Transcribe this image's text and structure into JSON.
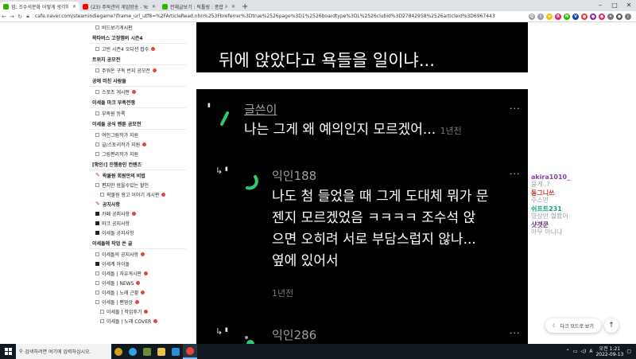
{
  "browser": {
    "tabs": [
      {
        "title": "힘: 조수석문화 어떻게 생각해?",
        "color": "#2db400",
        "active": true
      },
      {
        "title": "(23) 주둑관의 게임방송 - YouTube",
        "color": "#ff0000",
        "active": false
      },
      {
        "title": "전체글보기 : 픽툴링 : 종합 게시판",
        "color": "#2db400",
        "active": false
      }
    ],
    "new_tab": "+",
    "url": "cafe.naver.com/steamindiegame?iframe_url_utf8=%2FArticleRead.nhn%253Fbreferrer%3Dtrue%2526page%3D1%2526boardtype%3DL%2526clubid%3D27842958%2526articleid%3D6967443",
    "window_buttons": [
      "–",
      "□",
      "✕"
    ]
  },
  "sidebar": {
    "items": [
      {
        "kind": "item",
        "label": "비드보기게시판",
        "icon": true
      },
      {
        "kind": "head",
        "label": "왁타버스 고정멤버 시즌4"
      },
      {
        "kind": "item",
        "label": "고빈 시즌4 오디션 접수",
        "icon": true,
        "new": true
      },
      {
        "kind": "head",
        "label": "트위치 공모전"
      },
      {
        "kind": "item",
        "label": "주워온 구독 번지 공모전",
        "icon": true,
        "new": true
      },
      {
        "kind": "head",
        "label": "공에 미친 사람들"
      },
      {
        "kind": "item",
        "label": "스포츠 게시판",
        "icon": true,
        "new": true
      },
      {
        "kind": "head",
        "label": "이세돌 마크 부족전쟁"
      },
      {
        "kind": "item",
        "label": "부족원 등록",
        "icon": true
      },
      {
        "kind": "head",
        "label": "이세돌 공식 팬툰 공모전"
      },
      {
        "kind": "item",
        "label": "여인그림작가 지원",
        "icon": true
      },
      {
        "kind": "item",
        "label": "글/스토리작가 지원",
        "icon": true,
        "new": true
      },
      {
        "kind": "item",
        "label": "그림편리작가 지원",
        "icon": true
      },
      {
        "kind": "head",
        "label": "[확인!] 진행중인 컨텐츠"
      },
      {
        "kind": "pin",
        "label": "왁물원 회원만의 비법"
      },
      {
        "kind": "item",
        "label": "편지만 받을수있는 할인",
        "icon": true
      },
      {
        "kind": "item",
        "label": "왁물원 왕고 이야기 게시판",
        "icon": true,
        "new": true,
        "indent": true
      },
      {
        "kind": "pin",
        "label": "공지사항"
      },
      {
        "kind": "sq",
        "label": "카페 공지사항",
        "new": true
      },
      {
        "kind": "sq",
        "label": "마크 공지사항"
      },
      {
        "kind": "sq",
        "label": "이세돌 공지사항"
      },
      {
        "kind": "head",
        "label": "이세돌에 작업 쓴 글"
      },
      {
        "kind": "item",
        "label": "이세돌의 공지사항",
        "icon": true,
        "new": true
      },
      {
        "kind": "sq",
        "label": "이세계 아이돌"
      },
      {
        "kind": "item",
        "label": "이세돌 | 자유게시판",
        "icon": true,
        "new": true
      },
      {
        "kind": "item",
        "label": "이세돌 | NEWS",
        "icon": true,
        "new": true
      },
      {
        "kind": "item",
        "label": "이세돌 | 노래 근황",
        "icon": true,
        "new": true
      },
      {
        "kind": "item",
        "label": "이세돌 | 팬영상",
        "icon": true,
        "new": true
      },
      {
        "kind": "item",
        "label": "이세돌 | 작업후기",
        "icon": true,
        "new": true,
        "indent": true
      },
      {
        "kind": "item",
        "label": "이세돌 | 노래 COVER",
        "icon": true,
        "new": true,
        "indent": true
      }
    ]
  },
  "post": {
    "top_text": "뒤에 앉았다고 욕들을 일이냐..."
  },
  "comments": [
    {
      "author": "글쓴이",
      "text": "나는 그게 왜 예의인지 모르겠어...",
      "time": "1년전",
      "deco_color": "#2ecc71",
      "reply": false
    },
    {
      "author": "익인188",
      "lines": [
        "나도 첨 들었을 때 그게 도대체 뭐가 문",
        "젠지 모르겠었음 ㅋㅋㅋㅋ 조수석 앉",
        "으면 오히려 서로 부담스럽지 않나...",
        "옆에 있어서"
      ],
      "time": "1년전",
      "deco_color": "#2ecc71",
      "reply": true
    },
    {
      "author": "익인286",
      "deco_color": "#2ecc71",
      "reply": true
    }
  ],
  "more_glyph": "···",
  "chat": [
    {
      "name": "akira1010_",
      "name_color": "#8e44ad",
      "msg": "뭉게..?"
    },
    {
      "name": "동그니쓰",
      "name_color": "#c0392b",
      "msg": "주스만"
    },
    {
      "name": "쉬프트231",
      "name_color": "#16a085",
      "msg": "영상만 헐봤어"
    },
    {
      "name": "샷갯쿤",
      "name_color": "#6c3483",
      "msg": "아무 아니냐"
    }
  ],
  "dark_mode_label": "다크 모드로 보기",
  "top_button": "↑",
  "taskbar": {
    "search_placeholder": "검색하려면 여기에 입력하십시오.",
    "time": "오전 1:21",
    "date": "2022-09-13",
    "apps": [
      {
        "name": "cortana",
        "color": "#d4a017"
      },
      {
        "name": "edge",
        "color": "#2fa4e7"
      },
      {
        "name": "minecraft",
        "color": "#6a8d3a"
      },
      {
        "name": "explorer",
        "color": "#f0c24a"
      },
      {
        "name": "vscode",
        "color": "#2b8fd6"
      },
      {
        "name": "chrome",
        "color": "#e8453c",
        "active": true
      }
    ]
  }
}
